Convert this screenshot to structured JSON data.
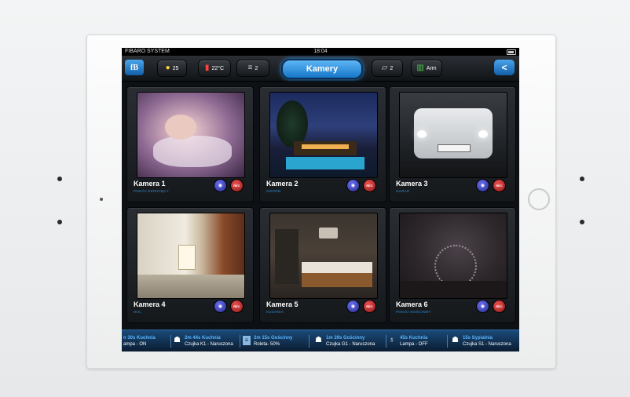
{
  "status_bar": {
    "carrier": "FIBARO SYSTEM",
    "time": "18:04"
  },
  "toolbar": {
    "logo_label": "fB",
    "lights_count": "25",
    "temperature": "22°C",
    "blinds_count": "2",
    "active_tab": "Kamery",
    "gates_count": "2",
    "alarm_label": "Arm",
    "back_label": "<"
  },
  "cameras": [
    {
      "name": "Kamera 1",
      "room": "POKÓJ DZIECIĘCY",
      "rec_label": "REC"
    },
    {
      "name": "Kamera 2",
      "room": "OGRÓD",
      "rec_label": "REC"
    },
    {
      "name": "Kamera 3",
      "room": "GARAŻ",
      "rec_label": "REC"
    },
    {
      "name": "Kamera 4",
      "room": "HOL",
      "rec_label": "REC"
    },
    {
      "name": "Kamera 5",
      "room": "KUCHNIA",
      "rec_label": "REC"
    },
    {
      "name": "Kamera 6",
      "room": "POKÓJ GOŚCINNY",
      "rec_label": "REC"
    }
  ],
  "events": [
    {
      "time_room": "n 30s Kuchnia",
      "desc": "ampa - ON"
    },
    {
      "time_room": "2m 44s Kuchnia",
      "desc": "Czujka K1 - Naruszona"
    },
    {
      "time_room": "2m 15s Gościnny",
      "desc": "Roleta- 50%"
    },
    {
      "time_room": "1m 29s Gościnny",
      "desc": "Czujka G1 - Naruszona"
    },
    {
      "time_room": "45s Kuchnia",
      "desc": "Lampa - OFF"
    },
    {
      "time_room": "15s Sypialnia",
      "desc": "Czujka S1 - Naruszona"
    }
  ],
  "colors": {
    "accent": "#1e88e5",
    "rec": "#d32f2f",
    "camera_button": "#3b3fb0"
  }
}
